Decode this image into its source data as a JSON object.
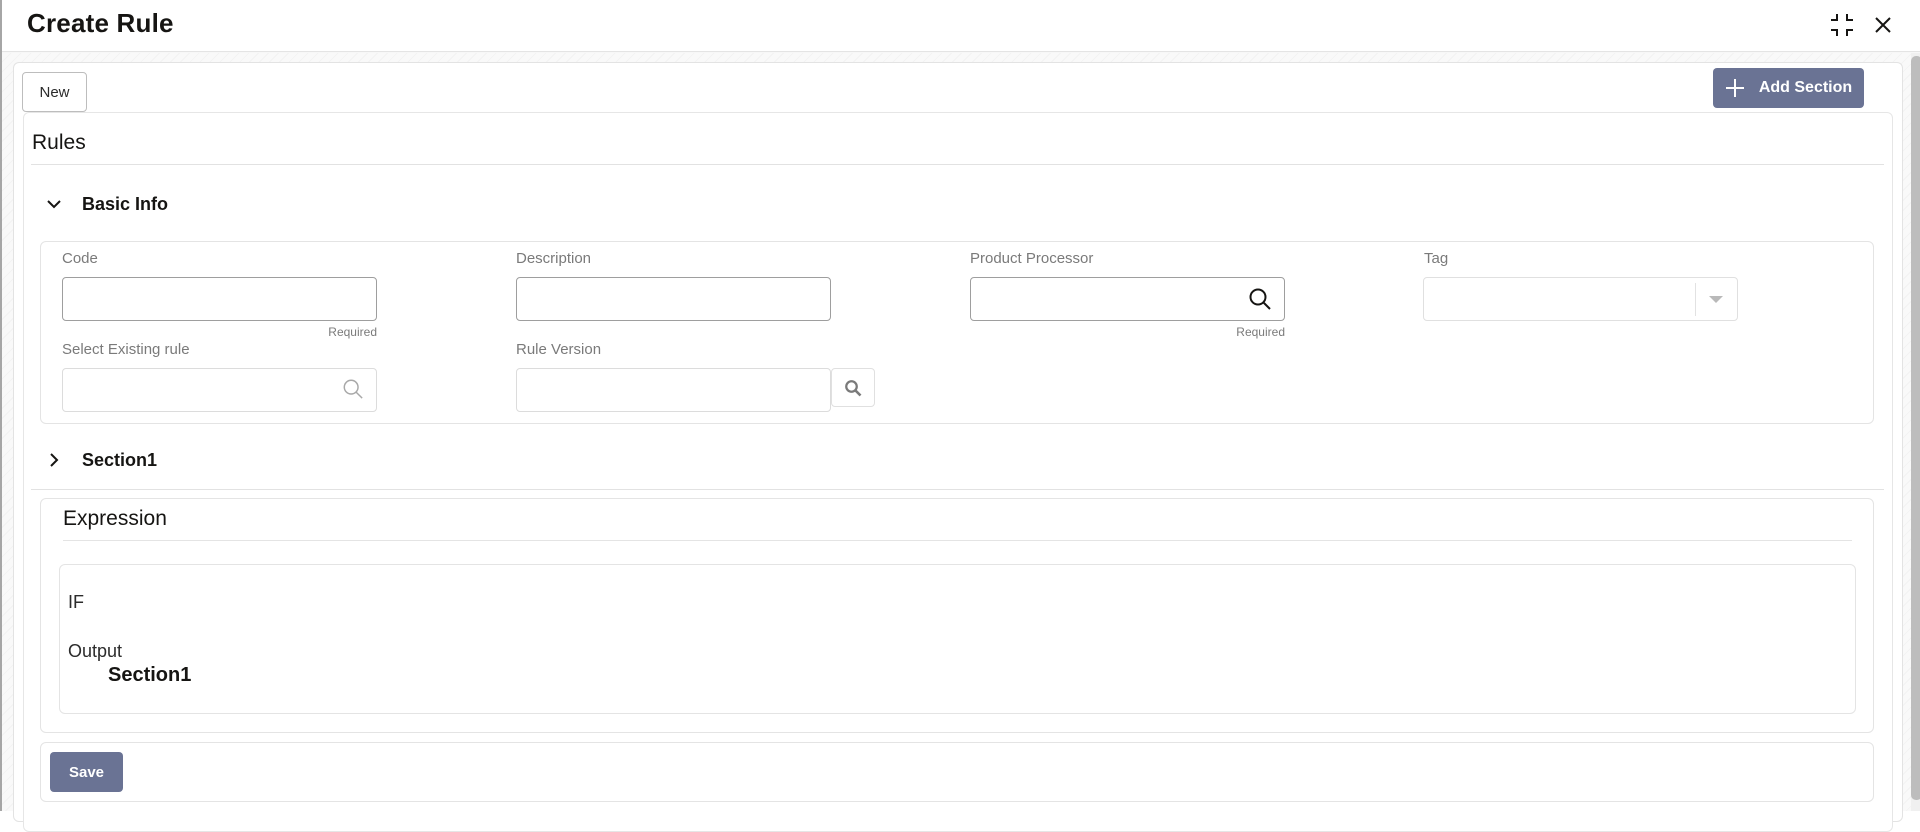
{
  "window": {
    "title": "Create Rule",
    "minimize_icon": "compress-icon",
    "close_icon": "close-icon"
  },
  "toolbar": {
    "new_label": "New",
    "add_section_label": "Add Section",
    "add_section_icon": "plus-icon"
  },
  "rules": {
    "title": "Rules",
    "basic_info": {
      "label": "Basic Info",
      "expanded": true,
      "fields": {
        "code": {
          "label": "Code",
          "value": "",
          "hint": "Required"
        },
        "description": {
          "label": "Description",
          "value": ""
        },
        "product_processor": {
          "label": "Product Processor",
          "value": "",
          "hint": "Required",
          "icon": "search-icon"
        },
        "tag": {
          "label": "Tag",
          "value": ""
        },
        "select_existing_rule": {
          "label": "Select Existing rule",
          "value": "",
          "icon": "search-icon"
        },
        "rule_version": {
          "label": "Rule Version",
          "value": "",
          "icon": "search-icon"
        }
      }
    },
    "section1": {
      "label": "Section1",
      "expanded": false
    }
  },
  "expression": {
    "title": "Expression",
    "if_label": "IF",
    "output_label": "Output",
    "output_value": "Section1"
  },
  "footer": {
    "save_label": "Save"
  },
  "colors": {
    "primary_button": "#6a7394",
    "border": "#e4e4e4",
    "label_text": "#7a7a7a"
  }
}
